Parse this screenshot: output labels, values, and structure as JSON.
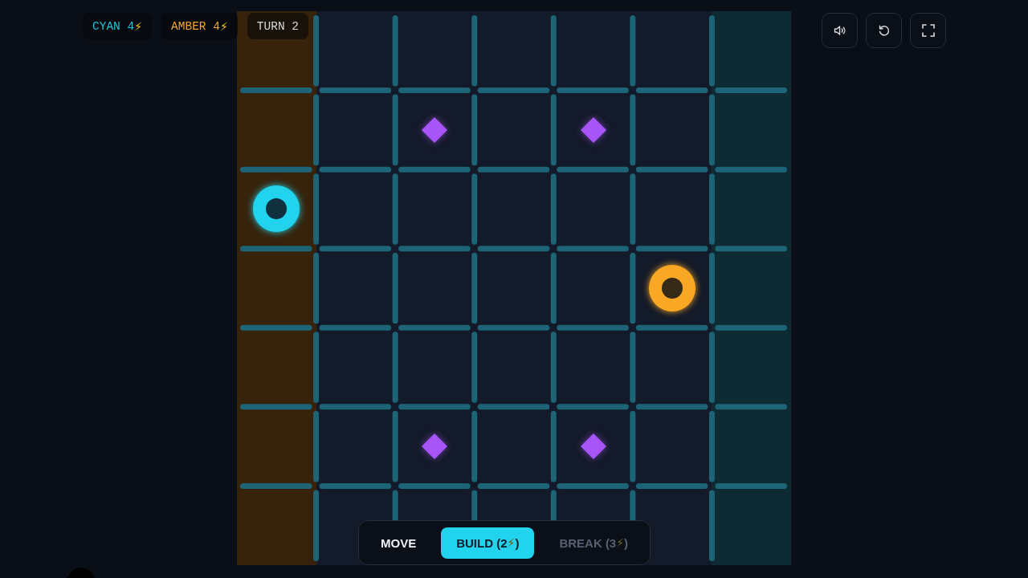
{
  "hud": {
    "players": [
      {
        "label": "CYAN 4",
        "symbol": "⚡",
        "color": "#22c3dc"
      },
      {
        "label": "AMBER 4",
        "symbol": "⚡",
        "color": "#efa636"
      }
    ],
    "turn": "TURN 2"
  },
  "board": {
    "rows": [
      [
        {
          "kind": "amber"
        },
        {
          "kind": "plain"
        },
        {
          "kind": "plain"
        },
        {
          "kind": "plain"
        },
        {
          "kind": "plain"
        },
        {
          "kind": "plain"
        },
        {
          "kind": "cyan"
        }
      ],
      [
        {
          "kind": "amber"
        },
        {
          "kind": "plain"
        },
        {
          "kind": "plain",
          "piece": {
            "kind": "gem"
          }
        },
        {
          "kind": "plain"
        },
        {
          "kind": "plain",
          "piece": {
            "kind": "gem"
          }
        },
        {
          "kind": "plain"
        },
        {
          "kind": "cyan"
        }
      ],
      [
        {
          "kind": "amber",
          "piece": {
            "kind": "token",
            "color": "#22d3ee"
          }
        },
        {
          "kind": "plain"
        },
        {
          "kind": "plain"
        },
        {
          "kind": "plain"
        },
        {
          "kind": "plain"
        },
        {
          "kind": "plain"
        },
        {
          "kind": "cyan"
        }
      ],
      [
        {
          "kind": "amber"
        },
        {
          "kind": "plain"
        },
        {
          "kind": "plain"
        },
        {
          "kind": "plain"
        },
        {
          "kind": "plain"
        },
        {
          "kind": "plain",
          "piece": {
            "kind": "token",
            "color": "#f9a825"
          }
        },
        {
          "kind": "cyan"
        }
      ],
      [
        {
          "kind": "amber"
        },
        {
          "kind": "plain"
        },
        {
          "kind": "plain"
        },
        {
          "kind": "plain"
        },
        {
          "kind": "plain"
        },
        {
          "kind": "plain"
        },
        {
          "kind": "cyan"
        }
      ],
      [
        {
          "kind": "amber"
        },
        {
          "kind": "plain"
        },
        {
          "kind": "plain",
          "piece": {
            "kind": "gem"
          }
        },
        {
          "kind": "plain"
        },
        {
          "kind": "plain",
          "piece": {
            "kind": "gem"
          }
        },
        {
          "kind": "plain"
        },
        {
          "kind": "cyan"
        }
      ],
      [
        {
          "kind": "amber"
        },
        {
          "kind": "plain"
        },
        {
          "kind": "plain"
        },
        {
          "kind": "plain"
        },
        {
          "kind": "plain"
        },
        {
          "kind": "plain"
        },
        {
          "kind": "cyan"
        }
      ]
    ]
  },
  "modes": [
    {
      "label": "MOVE",
      "selected": false,
      "disabled": false
    },
    {
      "label": "BUILD (2",
      "symbol": "⚡",
      "tail": ")",
      "selected": true,
      "disabled": false
    },
    {
      "label": "BREAK (3",
      "symbol": "⚡",
      "tail": ")",
      "selected": false,
      "disabled": true
    }
  ]
}
